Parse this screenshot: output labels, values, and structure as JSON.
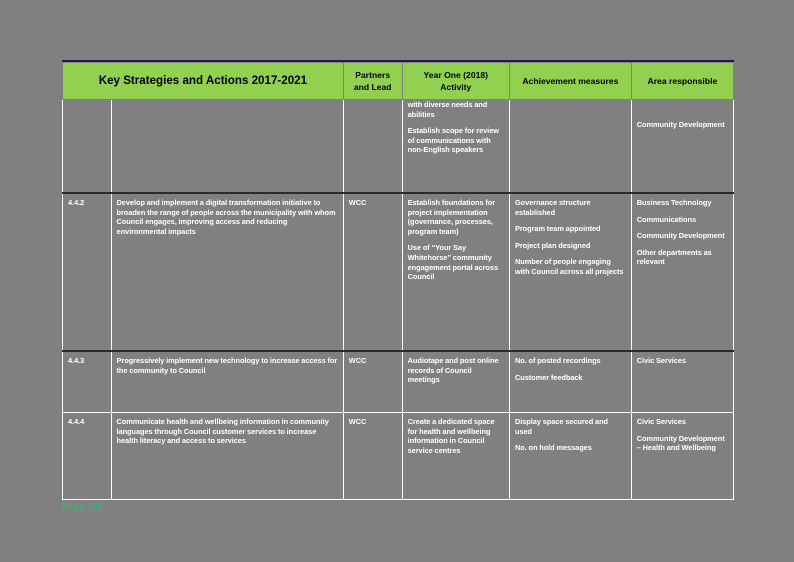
{
  "document": {
    "footer_label": "Page 102",
    "footer_color": "#2eb872",
    "header_fill": "#92d050",
    "page_background": "#808080"
  },
  "table": {
    "headers": {
      "strategies": "Key Strategies and Actions 2017-2021",
      "partners": "Partners and Lead",
      "year_one_line1": "Year One (2018)",
      "year_one_line2": "Activity",
      "achievement": "Achievement measures",
      "area": "Area responsible"
    },
    "rows": [
      {
        "number": "",
        "strategy": "",
        "partners": "",
        "year_one": [
          "with diverse needs and abilities",
          "Establish scope for review of communications with non-English speakers"
        ],
        "achievement": [],
        "area": [
          "Community Development"
        ]
      },
      {
        "number": "4.4.2",
        "strategy": "Develop and implement a digital transformation initiative to broaden the range of people across the municipality with whom Council engages, improving access and reducing environmental impacts",
        "partners": "WCC",
        "year_one": [
          "Establish foundations for project implementation (governance, processes, program team)",
          "Use of “Your Say Whitehorse” community engagement portal across Council"
        ],
        "achievement": [
          "Governance structure established",
          "Program team appointed",
          "Project plan designed",
          "Number of people engaging with Council across all projects"
        ],
        "area": [
          "Business Technology",
          "Communications",
          "Community Development",
          "Other departments as relevant"
        ]
      },
      {
        "number": "4.4.3",
        "strategy": "Progressively implement new technology to increase access for the community to Council",
        "partners": "WCC",
        "year_one": [
          "Audiotape and post online records of Council meetings"
        ],
        "achievement": [
          "No. of posted recordings",
          "Customer feedback"
        ],
        "area": [
          "Civic Services"
        ]
      },
      {
        "number": "4.4.4",
        "strategy": "Communicate health and wellbeing information in community languages through Council customer services to increase health literacy and access to services",
        "partners": "WCC",
        "year_one": [
          "Create a dedicated space for health and wellbeing information in Council service centres"
        ],
        "achievement": [
          "Display space secured and used",
          "No. on hold messages"
        ],
        "area": [
          "Civic Services",
          "Community Development – Health and Wellbeing"
        ]
      }
    ]
  }
}
